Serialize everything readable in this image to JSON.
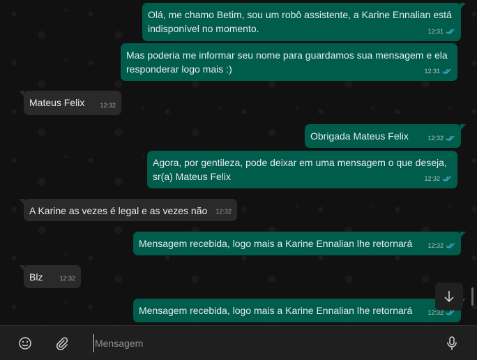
{
  "messages": [
    {
      "direction": "out",
      "lines": [
        "Olá, me chamo Betim, sou um robô assistente, a Karine Ennalian está",
        "indisponível no momento."
      ],
      "time": "12:31",
      "read": true
    },
    {
      "direction": "out",
      "lines": [
        "Mas poderia me informar seu nome para guardamos sua mensagem e ela",
        "responderar logo mais :)"
      ],
      "time": "12:31",
      "read": true
    },
    {
      "direction": "in",
      "lines": [
        "Mateus Felix"
      ],
      "time": "12:32"
    },
    {
      "direction": "out",
      "lines": [
        "Obrigada Mateus Felix"
      ],
      "time": "12:32",
      "read": true
    },
    {
      "direction": "out",
      "lines": [
        "Agora, por gentileza, pode deixar em uma mensagem o que deseja,",
        "sr(a) Mateus Felix"
      ],
      "time": "12:32",
      "read": true
    },
    {
      "direction": "in",
      "lines": [
        "A Karine as vezes é legal e as vezes não"
      ],
      "time": "12:32"
    },
    {
      "direction": "out",
      "lines": [
        "Mensagem recebida, logo mais a Karine Ennalian lhe retornará"
      ],
      "time": "12:32",
      "read": true
    },
    {
      "direction": "in",
      "lines": [
        "Blz"
      ],
      "time": "12:32"
    },
    {
      "direction": "out",
      "lines": [
        "Mensagem recebida, logo mais a Karine Ennalian lhe retornará"
      ],
      "time": "12:32",
      "read": true
    }
  ],
  "composer": {
    "placeholder": "Mensagem",
    "emoji_icon": "emoji-icon",
    "attach_icon": "paperclip-icon",
    "mic_icon": "microphone-icon"
  },
  "colors": {
    "outgoing_bubble": "#005c4b",
    "incoming_bubble": "#2a2a2a",
    "read_check": "#53bdeb"
  }
}
